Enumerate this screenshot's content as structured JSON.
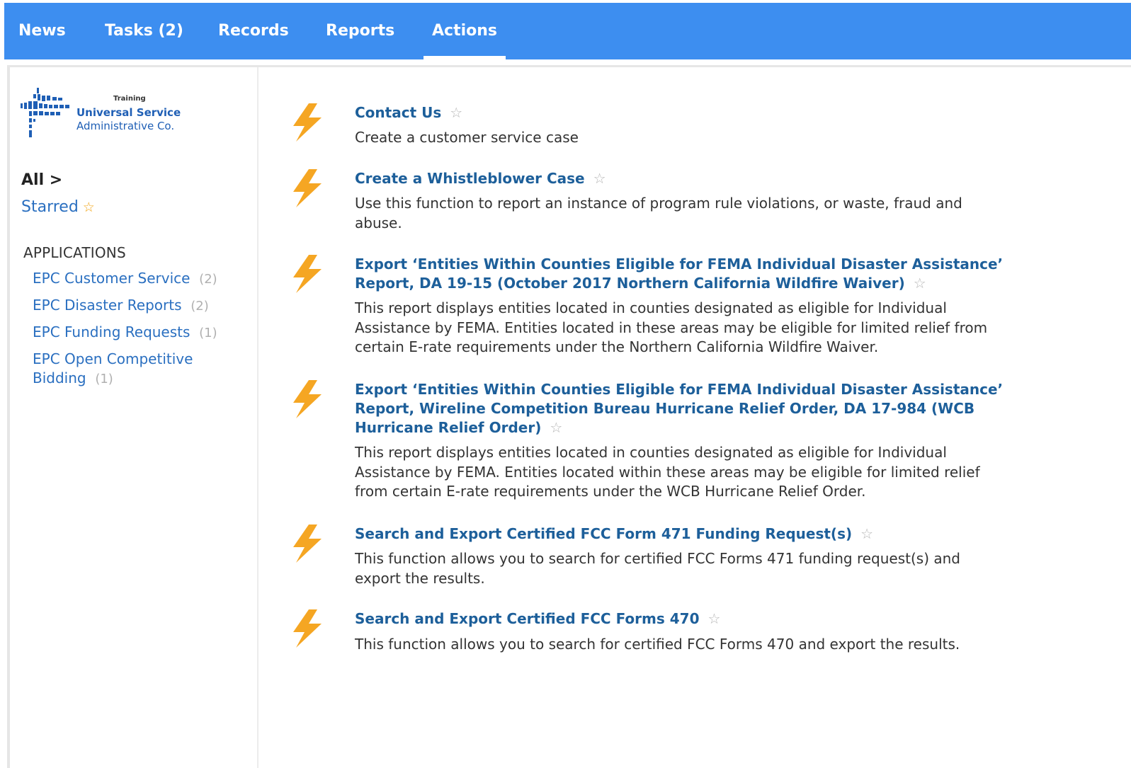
{
  "nav": {
    "items": [
      {
        "label": "News"
      },
      {
        "label": "Tasks (2)"
      },
      {
        "label": "Records"
      },
      {
        "label": "Reports"
      },
      {
        "label": "Actions"
      }
    ],
    "active": "Actions"
  },
  "logo": {
    "training": "Training",
    "line1": "Universal Service",
    "line2": "Administrative Co."
  },
  "sidebar": {
    "all_label": "All >",
    "starred_label": "Starred",
    "applications_heading": "APPLICATIONS",
    "applications": [
      {
        "label": "EPC Customer Service",
        "count": "(2)"
      },
      {
        "label": "EPC Disaster Reports",
        "count": "(2)"
      },
      {
        "label": "EPC Funding Requests",
        "count": "(1)"
      },
      {
        "label": "EPC Open Competitive Bidding",
        "count": "(1)"
      }
    ]
  },
  "actions": [
    {
      "title": "Contact Us",
      "description": "Create a customer service case"
    },
    {
      "title": "Create a Whistleblower Case",
      "description": "Use this function to report an instance of program rule violations, or waste, fraud and abuse."
    },
    {
      "title": "Export ‘Entities Within Counties Eligible for FEMA Individual Disaster Assistance’ Report, DA 19-15 (October 2017 Northern California Wildfire Waiver)",
      "description": "This report displays entities located in counties designated as eligible for Individual Assistance by FEMA. Entities located in these areas may be eligible for limited relief from certain E-rate requirements under the Northern California Wildfire Waiver."
    },
    {
      "title": "Export ‘Entities Within Counties Eligible for FEMA Individual Disaster Assistance’ Report, Wireline Competition Bureau Hurricane Relief Order, DA 17-984 (WCB Hurricane Relief Order)",
      "description": "This report displays entities located in counties designated as eligible for Individual Assistance by FEMA. Entities located within these areas may be eligible for limited relief from certain E-rate requirements under the WCB Hurricane Relief Order."
    },
    {
      "title": "Search and Export Certified FCC Form 471 Funding Request(s)",
      "description": "This function allows you to search for certified FCC Forms 471 funding request(s) and export the results."
    },
    {
      "title": "Search and Export Certified FCC Forms 470",
      "description": "This function allows you to search for certified FCC Forms 470 and export the results."
    }
  ],
  "icons": {
    "action_icon": "lightning-bolt-icon",
    "favorite_icon": "star-outline-icon",
    "starred_icon": "star-filled-icon"
  },
  "colors": {
    "topbar": "#3d8ef0",
    "link": "#2a6fc0",
    "action_title": "#1d5f9a",
    "bolt": "#f5a623",
    "star_filled": "#f2a516"
  }
}
